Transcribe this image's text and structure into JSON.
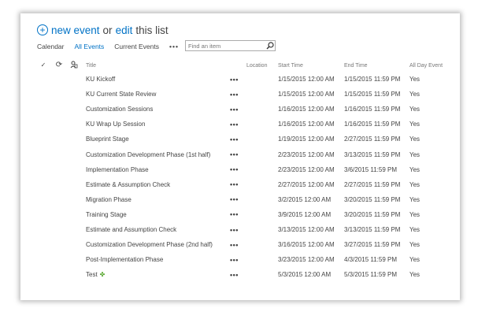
{
  "hero": {
    "new_event": "new event",
    "or": "or",
    "edit": "edit",
    "this_list": "this list"
  },
  "views": {
    "items": [
      "Calendar",
      "All Events",
      "Current Events"
    ],
    "active": "All Events",
    "more": "•••"
  },
  "search": {
    "placeholder": "Find an item"
  },
  "columns": {
    "title": "Title",
    "location": "Location",
    "start": "Start Time",
    "end": "End Time",
    "allday": "All Day Event"
  },
  "row_menu": "•••",
  "rows": [
    {
      "title": "KU Kickoff",
      "start": "1/15/2015 12:00 AM",
      "end": "1/15/2015 11:59 PM",
      "allday": "Yes"
    },
    {
      "title": "KU Current State Review",
      "start": "1/15/2015 12:00 AM",
      "end": "1/15/2015 11:59 PM",
      "allday": "Yes"
    },
    {
      "title": "Customization Sessions",
      "start": "1/16/2015 12:00 AM",
      "end": "1/16/2015 11:59 PM",
      "allday": "Yes"
    },
    {
      "title": "KU Wrap Up Session",
      "start": "1/16/2015 12:00 AM",
      "end": "1/16/2015 11:59 PM",
      "allday": "Yes"
    },
    {
      "title": "Blueprint Stage",
      "start": "1/19/2015 12:00 AM",
      "end": "2/27/2015 11:59 PM",
      "allday": "Yes"
    },
    {
      "title": "Customization Development Phase (1st half)",
      "start": "2/23/2015 12:00 AM",
      "end": "3/13/2015 11:59 PM",
      "allday": "Yes"
    },
    {
      "title": "Implementation Phase",
      "start": "2/23/2015 12:00 AM",
      "end": "3/6/2015 11:59 PM",
      "allday": "Yes"
    },
    {
      "title": "Estimate & Assumption Check",
      "start": "2/27/2015 12:00 AM",
      "end": "2/27/2015 11:59 PM",
      "allday": "Yes"
    },
    {
      "title": "Migration Phase",
      "start": "3/2/2015 12:00 AM",
      "end": "3/20/2015 11:59 PM",
      "allday": "Yes"
    },
    {
      "title": "Training Stage",
      "start": "3/9/2015 12:00 AM",
      "end": "3/20/2015 11:59 PM",
      "allday": "Yes"
    },
    {
      "title": "Estimate and Assumption Check",
      "start": "3/13/2015 12:00 AM",
      "end": "3/13/2015 11:59 PM",
      "allday": "Yes"
    },
    {
      "title": "Customization Development Phase (2nd half)",
      "start": "3/16/2015 12:00 AM",
      "end": "3/27/2015 11:59 PM",
      "allday": "Yes"
    },
    {
      "title": "Post-Implementation Phase",
      "start": "3/23/2015 12:00 AM",
      "end": "4/3/2015 11:59 PM",
      "allday": "Yes"
    },
    {
      "title": "Test",
      "start": "5/3/2015 12:00 AM",
      "end": "5/3/2015 11:59 PM",
      "allday": "Yes",
      "new_badge": "✤"
    }
  ]
}
